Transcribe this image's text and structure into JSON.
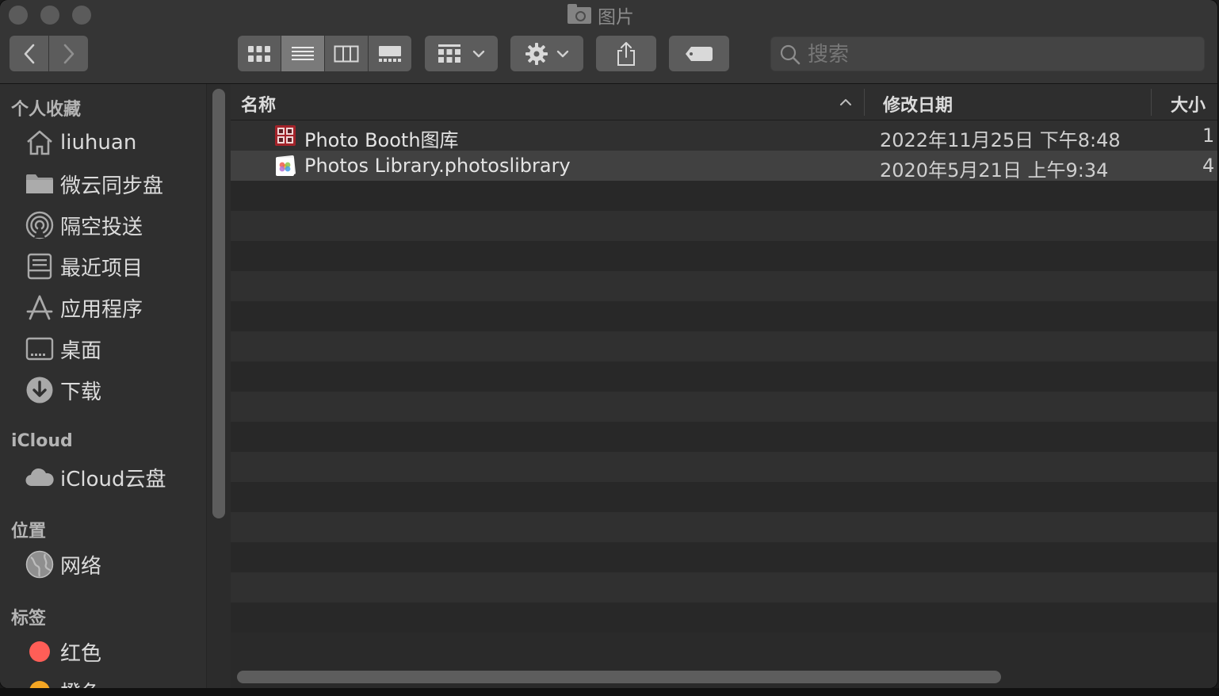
{
  "window": {
    "title": "图片"
  },
  "toolbar": {
    "back_icon": "chevron-left-icon",
    "forward_icon": "chevron-right-icon",
    "view_modes": [
      "icon-view",
      "list-view",
      "column-view",
      "gallery-view"
    ],
    "active_view": "list-view",
    "search": {
      "placeholder": "搜索",
      "value": ""
    }
  },
  "sidebar": {
    "favorites_title": "个人收藏",
    "favorites": [
      {
        "label": "liuhuan",
        "icon": "home-icon"
      },
      {
        "label": "微云同步盘",
        "icon": "folder-icon"
      },
      {
        "label": "隔空投送",
        "icon": "airdrop-icon"
      },
      {
        "label": "最近项目",
        "icon": "recents-icon"
      },
      {
        "label": "应用程序",
        "icon": "applications-icon"
      },
      {
        "label": "桌面",
        "icon": "desktop-icon"
      },
      {
        "label": "下载",
        "icon": "download-icon"
      }
    ],
    "icloud_title": "iCloud",
    "icloud": [
      {
        "label": "iCloud云盘",
        "icon": "cloud-icon"
      }
    ],
    "locations_title": "位置",
    "locations": [
      {
        "label": "网络",
        "icon": "network-globe-icon"
      }
    ],
    "tags_title": "标签",
    "tags": [
      {
        "label": "红色",
        "color": "#ff5e57"
      },
      {
        "label": "橙色",
        "color": "#f4a623"
      }
    ]
  },
  "columns": {
    "name": "名称",
    "date": "修改日期",
    "size": "大小"
  },
  "files": [
    {
      "name": "Photo Booth图库",
      "date": "2022年11月25日 下午8:48",
      "size": "1",
      "icon": "photo-booth-library-icon"
    },
    {
      "name": "Photos Library.photoslibrary",
      "date": "2020年5月21日 上午9:34",
      "size": "4",
      "icon": "photos-library-icon",
      "selected": true
    }
  ],
  "colors": {
    "accent_red": "#ff5e57",
    "accent_orange": "#f4a623"
  }
}
